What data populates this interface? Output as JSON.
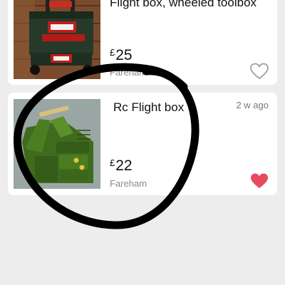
{
  "listings": [
    {
      "title": "Flight box, wheeled toolbox",
      "currency": "£",
      "price": "25",
      "location": "Fareham",
      "favorited": false,
      "image_icon": "toolbox-photo"
    },
    {
      "title": "Rc Flight box",
      "currency": "£",
      "price": "22",
      "location": "Fareham",
      "posted": "2 w ago",
      "favorited": true,
      "image_icon": "flight-box-photo"
    }
  ],
  "colors": {
    "background": "#ededed",
    "card": "#ffffff",
    "favorite_active": "#e84a5f",
    "favorite_inactive": "#9e9e9e",
    "annotation": "#000000"
  }
}
